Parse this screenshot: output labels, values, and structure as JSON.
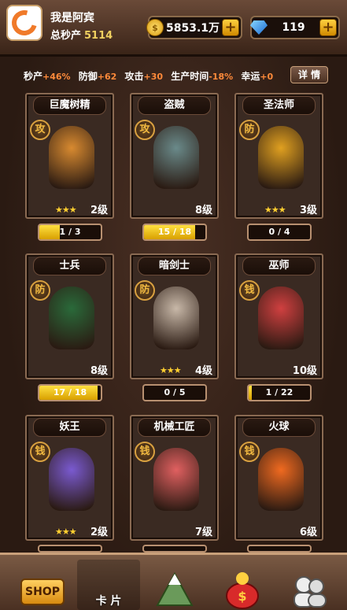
{
  "header": {
    "player_name": "我是阿宾",
    "total_label": "总秒产",
    "total_value": "5114",
    "gold": "5853.1万",
    "gems": "119"
  },
  "stats": [
    {
      "label": "秒产",
      "value": "+46%"
    },
    {
      "label": "防御",
      "value": "+62"
    },
    {
      "label": "攻击",
      "value": "+30"
    },
    {
      "label": "生产时间",
      "value": "-18%"
    },
    {
      "label": "幸运",
      "value": "+0"
    }
  ],
  "detail_label": "详 情",
  "cards": [
    {
      "name": "巨魔树精",
      "badge": "攻",
      "stars": "★★★",
      "level": "2级",
      "progress": "1 / 3",
      "fill": 0.333,
      "color": "#d88a30"
    },
    {
      "name": "盗贼",
      "badge": "攻",
      "stars": "",
      "level": "8级",
      "progress": "15 / 18",
      "fill": 0.833,
      "color": "#6a8a8a"
    },
    {
      "name": "圣法师",
      "badge": "防",
      "stars": "★★★",
      "level": "3级",
      "progress": "0 / 4",
      "fill": 0,
      "color": "#e0a020"
    },
    {
      "name": "士兵",
      "badge": "防",
      "stars": "",
      "level": "8级",
      "progress": "17 / 18",
      "fill": 0.944,
      "color": "#2a6a3a"
    },
    {
      "name": "暗剑士",
      "badge": "防",
      "stars": "★★★",
      "level": "4级",
      "progress": "0 / 5",
      "fill": 0,
      "color": "#c8b8a8"
    },
    {
      "name": "巫师",
      "badge": "钱",
      "stars": "",
      "level": "10级",
      "progress": "1 / 22",
      "fill": 0.045,
      "color": "#d04040"
    },
    {
      "name": "妖王",
      "badge": "钱",
      "stars": "★★★",
      "level": "2级",
      "progress": "",
      "fill": 0,
      "color": "#7a5ad0"
    },
    {
      "name": "机械工匠",
      "badge": "钱",
      "stars": "",
      "level": "7级",
      "progress": "",
      "fill": 0,
      "color": "#e06060"
    },
    {
      "name": "火球",
      "badge": "钱",
      "stars": "",
      "level": "6级",
      "progress": "",
      "fill": 0,
      "color": "#f06a20"
    }
  ],
  "nav": {
    "shop": "SHOP",
    "cards": "卡 片"
  }
}
